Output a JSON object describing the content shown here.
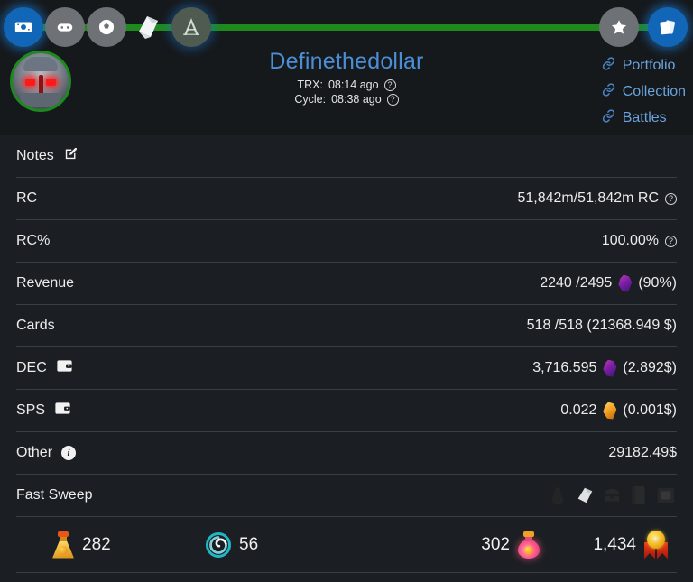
{
  "header": {
    "nav_icons": [
      {
        "name": "money-card-icon",
        "state": "active"
      },
      {
        "name": "gamepad-icon",
        "state": "dim"
      },
      {
        "name": "ball-gear-icon",
        "state": "dim"
      },
      {
        "name": "card-pack-icon",
        "state": "plain"
      },
      {
        "name": "arena-a-icon",
        "state": "alt"
      },
      {
        "name": "star-icon",
        "state": "dim"
      },
      {
        "name": "cards-icon",
        "state": "active"
      }
    ],
    "progress_bar_color": "#1e8a1e",
    "avatar_name": "player-avatar",
    "account_name": "Definethedollar",
    "account_name_color": "#4c8ed6",
    "trx_label": "TRX:",
    "trx_value": "08:14 ago",
    "cycle_label": "Cycle:",
    "cycle_value": "08:38 ago",
    "help_glyph": "?",
    "links": [
      {
        "label": "Portfolio",
        "icon": "link-icon"
      },
      {
        "label": "Collection",
        "icon": "link-icon"
      },
      {
        "label": "Battles",
        "icon": "link-icon"
      }
    ],
    "link_color": "#6aa3dd"
  },
  "rows": {
    "notes": {
      "label": "Notes",
      "icon": "edit-pencil-icon"
    },
    "rc": {
      "label": "RC",
      "value": "51,842m/51,842m RC",
      "help": "?"
    },
    "rc_percent": {
      "label": "RC%",
      "value": "100.00%",
      "help": "?"
    },
    "revenue": {
      "label": "Revenue",
      "value": "2240 /2495",
      "suffix": "(90%)",
      "icon": "dec-gem-icon"
    },
    "cards": {
      "label": "Cards",
      "value": "518 /518 (21368.949 $)"
    },
    "dec": {
      "label": "DEC",
      "icon": "wallet-icon",
      "value": "3,716.595",
      "suffix": "(2.892$)",
      "gem": "dec-gem-icon"
    },
    "sps": {
      "label": "SPS",
      "icon": "wallet-icon",
      "value": "0.022",
      "suffix": "(0.001$)",
      "gem": "sps-gem-icon"
    },
    "other": {
      "label": "Other",
      "icon": "info-icon",
      "value": "29182.49$"
    },
    "fast_sweep": {
      "label": "Fast Sweep",
      "icons": [
        "sweep-potion-icon",
        "sweep-pack-icon",
        "sweep-chest-icon",
        "sweep-card-icon",
        "sweep-frame-icon"
      ]
    }
  },
  "stats": [
    {
      "name": "legendary-potion",
      "icon": "gold-potion-icon",
      "value": "282",
      "order": "icon-first"
    },
    {
      "name": "energy",
      "icon": "energy-spiral-icon",
      "value": "56",
      "order": "icon-first"
    },
    {
      "name": "alchemy-potion",
      "icon": "pink-potion-icon",
      "value": "302",
      "order": "value-first"
    },
    {
      "name": "rating-medal",
      "icon": "medal-icon",
      "value": "1,434",
      "order": "value-first"
    }
  ],
  "colors": {
    "background": "#1b1f23",
    "header_background": "#16191c",
    "divider": "#3a3f44",
    "accent_blue": "#1166b8",
    "accent_green": "#1e8a1e",
    "text": "#ececec"
  }
}
